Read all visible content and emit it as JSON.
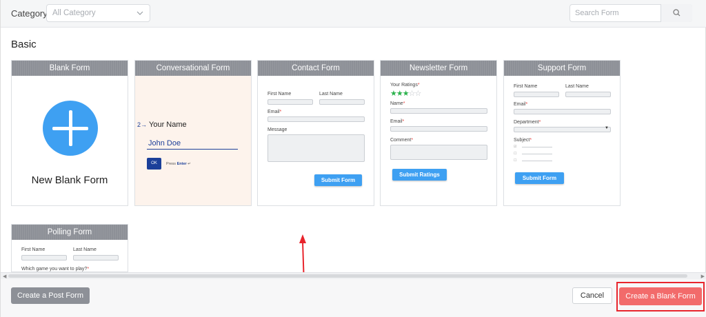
{
  "toolbar": {
    "category_label": "Category",
    "category_placeholder": "All Category",
    "search_placeholder": "Search Form"
  },
  "section": {
    "title": "Basic"
  },
  "cards": {
    "blank": {
      "title": "Blank Form",
      "label": "New Blank Form"
    },
    "conversational": {
      "title": "Conversational Form",
      "question": "Your Name",
      "answer": "John Doe",
      "ok": "OK",
      "hint_prefix": "Press ",
      "hint_key": "Enter",
      "hint_suffix": " ↵"
    },
    "contact": {
      "title": "Contact Form",
      "first_name": "First Name",
      "last_name": "Last Name",
      "email": "Email",
      "message": "Message",
      "submit": "Submit Form"
    },
    "newsletter": {
      "title": "Newsletter Form",
      "ratings": "Your Ratings",
      "name": "Name",
      "email": "Email",
      "comment": "Comment",
      "submit": "Submit Ratings",
      "rating_value": 3,
      "rating_max": 5
    },
    "support": {
      "title": "Support Form",
      "first_name": "First Name",
      "last_name": "Last Name",
      "email": "Email",
      "department": "Department",
      "subject": "Subject",
      "submit": "Submit Form"
    },
    "polling": {
      "title": "Polling Form",
      "first_name": "First Name",
      "last_name": "Last Name",
      "question": "Which game you want to play?"
    }
  },
  "footer": {
    "post_form": "Create a Post Form",
    "cancel": "Cancel",
    "blank_form": "Create a Blank Form"
  },
  "colors": {
    "accent_blue": "#3ea0f2",
    "card_header": "#8d9097",
    "create_button": "#f26b6b",
    "highlight_box": "#e8242c",
    "conversational_blue": "#1b3f99"
  }
}
